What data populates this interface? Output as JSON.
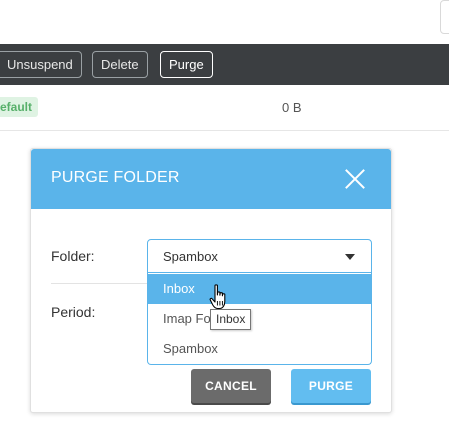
{
  "toolbar": {
    "unsuspend_label": "Unsuspend",
    "delete_label": "Delete",
    "purge_label": "Purge"
  },
  "row": {
    "badge": "efault",
    "size": "0 B"
  },
  "modal": {
    "title": "PURGE FOLDER",
    "folder_label": "Folder:",
    "period_label": "Period:",
    "folder_selected": "Spambox",
    "folder_options": [
      "Inbox",
      "Imap Fo",
      "Spambox"
    ],
    "cancel_label": "CANCEL",
    "purge_label": "PURGE"
  },
  "tooltip": {
    "text": "Inbox"
  },
  "icons": {
    "close": "close-icon",
    "caret": "chevron-down-icon",
    "cursor": "hand-cursor-icon"
  },
  "colors": {
    "accent": "#5ab4ea",
    "toolbar_bg": "#3b3e41",
    "badge_bg": "#dff3e3",
    "badge_text": "#57b06a",
    "cancel_bg": "#6b6b6b"
  }
}
